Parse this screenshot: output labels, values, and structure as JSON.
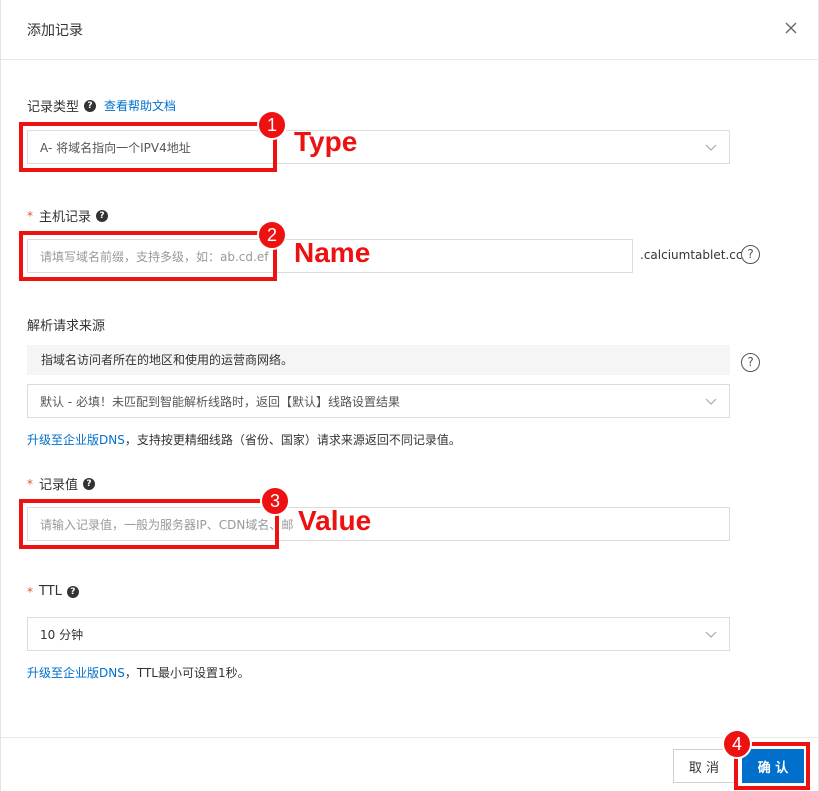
{
  "dialog": {
    "title": "添加记录"
  },
  "record_type": {
    "label": "记录类型",
    "help_link": "查看帮助文档",
    "value": "A- 将域名指向一个IPV4地址"
  },
  "host_record": {
    "label": "主机记录",
    "placeholder": "请填写域名前缀，支持多级，如：ab.cd.ef",
    "suffix": ".calciumtablet.cc"
  },
  "source": {
    "label": "解析请求来源",
    "description": "指域名访问者所在的地区和使用的运营商网络。",
    "value": "默认 - 必填！未匹配到智能解析线路时，返回【默认】线路设置结果",
    "hint_link": "升级至企业版DNS",
    "hint_text": "，支持按更精细线路（省份、国家）请求来源返回不同记录值。"
  },
  "record_value": {
    "label": "记录值",
    "placeholder": "请输入记录值，一般为服务器IP、CDN域名、邮"
  },
  "ttl": {
    "label": "TTL",
    "value": "10 分钟",
    "hint_link": "升级至企业版DNS",
    "hint_text": "，TTL最小可设置1秒。"
  },
  "footer": {
    "cancel_label": "取 消",
    "confirm_label": "确 认"
  },
  "annotations": [
    {
      "number": "1",
      "text": "Type"
    },
    {
      "number": "2",
      "text": "Name"
    },
    {
      "number": "3",
      "text": "Value"
    },
    {
      "number": "4",
      "text": ""
    }
  ],
  "colors": {
    "accent": "#0070cc",
    "annotation": "#ee1111",
    "required": "#e5533e"
  }
}
